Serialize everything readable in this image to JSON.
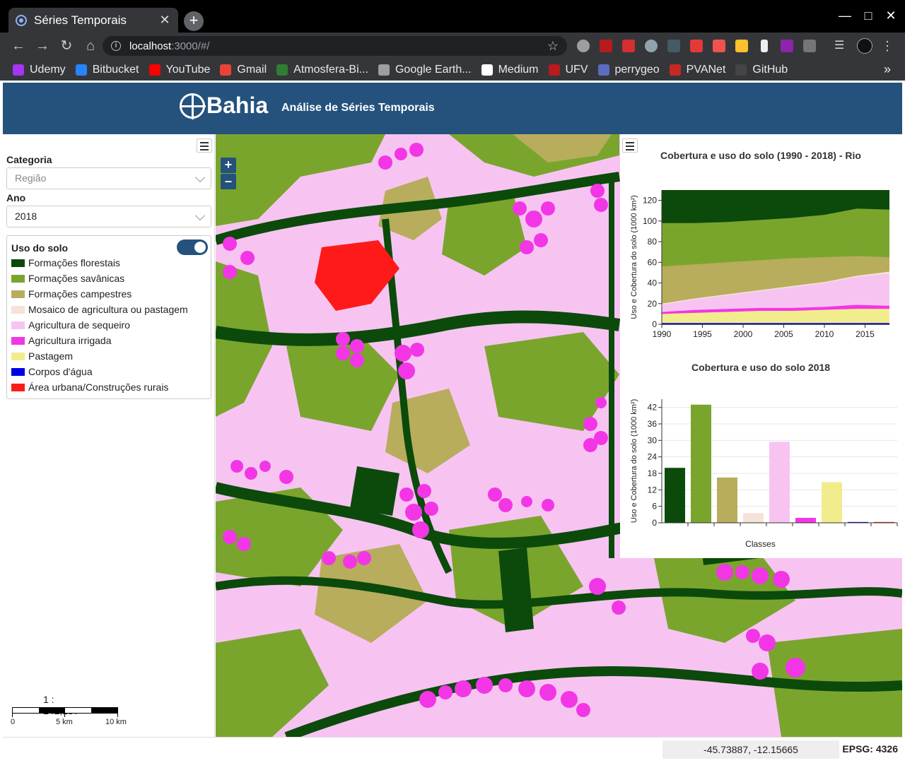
{
  "browser": {
    "tab_title": "Séries Temporais",
    "url_host": "localhost",
    "url_rest": ":3000/#/",
    "bookmarks": [
      {
        "label": "Udemy",
        "color": "#a435f0"
      },
      {
        "label": "Bitbucket",
        "color": "#2684ff"
      },
      {
        "label": "YouTube",
        "color": "#ff0000"
      },
      {
        "label": "Gmail",
        "color": "#ea4335"
      },
      {
        "label": "Atmosfera-Bi...",
        "color": "#2e7d32"
      },
      {
        "label": "Google Earth...",
        "color": "#9e9e9e"
      },
      {
        "label": "Medium",
        "color": "#ffffff"
      },
      {
        "label": "UFV",
        "color": "#b71c1c"
      },
      {
        "label": "perrygeo",
        "color": "#5c6bc0"
      },
      {
        "label": "PVANet",
        "color": "#c62828"
      },
      {
        "label": "GitHub",
        "color": "#444444"
      }
    ],
    "bookmarks_more": "»"
  },
  "header": {
    "logo_text": "Bahia",
    "subtitle": "Análise de Séries Temporais"
  },
  "sidebar": {
    "categoria_label": "Categoria",
    "categoria_placeholder": "Região",
    "ano_label": "Ano",
    "ano_value": "2018",
    "legend_title": "Uso do solo",
    "legend_items": [
      {
        "label": "Formações florestais",
        "color": "#0b4a0b"
      },
      {
        "label": "Formações savânicas",
        "color": "#7aa52d"
      },
      {
        "label": "Formações campestres",
        "color": "#b8ad5c"
      },
      {
        "label": "Mosaico de agricultura ou pastagem",
        "color": "#f5e2d8"
      },
      {
        "label": "Agricultura de sequeiro",
        "color": "#f7c4f2"
      },
      {
        "label": "Agricultura irrigada",
        "color": "#f236e6"
      },
      {
        "label": "Pastagem",
        "color": "#f2ed8c"
      },
      {
        "label": "Corpos d'água",
        "color": "#0000e6"
      },
      {
        "label": "Área urbana/Construções rurais",
        "color": "#ff1a1a"
      }
    ],
    "scale_ratio": "1 : 242,137",
    "scale_labels": [
      "0",
      "5 km",
      "10 km"
    ]
  },
  "status": {
    "coordinates": "-45.73887, -12.15665",
    "epsg": "EPSG: 4326"
  },
  "chart_data": [
    {
      "type": "area",
      "title": "Cobertura e uso do solo (1990 - 2018) - Rio",
      "ylabel": "Uso e Cobertura do solo (1000 km²)",
      "xlabel": "",
      "x": [
        1990,
        1994,
        1998,
        2002,
        2006,
        2010,
        2014,
        2018
      ],
      "xticks": [
        1990,
        1995,
        2000,
        2005,
        2010,
        2015
      ],
      "yticks": [
        0,
        20,
        40,
        60,
        80,
        100,
        120
      ],
      "ylim": [
        0,
        130
      ],
      "xlim": [
        1990,
        2018
      ],
      "stack_top_series": [
        {
          "name": "Corpos d'água",
          "color": "#0000e6",
          "values": [
            0.3,
            0.3,
            0.3,
            0.3,
            0.3,
            0.3,
            0.3,
            0.3
          ]
        },
        {
          "name": "Pastagem",
          "color": "#f2ed8c",
          "values": [
            10,
            11,
            12,
            13,
            13,
            14,
            15,
            15
          ]
        },
        {
          "name": "Agricultura irrigada",
          "color": "#f236e6",
          "values": [
            11,
            13,
            14,
            15,
            15,
            16,
            18,
            17
          ]
        },
        {
          "name": "Agricultura de sequeiro",
          "color": "#f7c4f2",
          "values": [
            19,
            24,
            28,
            32,
            36,
            40,
            46,
            49
          ]
        },
        {
          "name": "Mosaico de agricultura ou pastagem",
          "color": "#f5e2d8",
          "values": [
            20,
            25,
            29,
            33,
            37,
            41,
            47,
            51
          ]
        },
        {
          "name": "Formações campestres",
          "color": "#b8ad5c",
          "values": [
            56,
            58,
            60,
            62,
            64,
            65,
            66,
            65
          ]
        },
        {
          "name": "Formações savânicas",
          "color": "#7aa52d",
          "values": [
            98,
            98,
            99,
            101,
            103,
            106,
            112,
            111
          ]
        },
        {
          "name": "Formações florestais",
          "color": "#0b4a0b",
          "values": [
            130,
            130,
            130,
            130,
            130,
            130,
            130,
            130
          ]
        }
      ]
    },
    {
      "type": "bar",
      "title": "Cobertura e uso do solo 2018",
      "xlabel": "Classes",
      "ylabel": "Uso e Cobertura do solo (1000 km²)",
      "ylim": [
        0,
        45
      ],
      "yticks": [
        0,
        6,
        12,
        18,
        24,
        30,
        36,
        42
      ],
      "categories": [
        "Formações florestais",
        "Formações savânicas",
        "Formações campestres",
        "Mosaico de agricultura ou pastagem",
        "Agricultura de sequeiro",
        "Agricultura irrigada",
        "Pastagem",
        "Corpos d'água",
        "Área urbana/Construções rurais"
      ],
      "colors": [
        "#0b4a0b",
        "#7aa52d",
        "#b8ad5c",
        "#f5e2d8",
        "#f7c4f2",
        "#f236e6",
        "#f2ed8c",
        "#0000e6",
        "#ff1a1a"
      ],
      "values": [
        20,
        43,
        16.5,
        3.5,
        29.5,
        1.8,
        14.8,
        0.3,
        0.3
      ]
    }
  ]
}
